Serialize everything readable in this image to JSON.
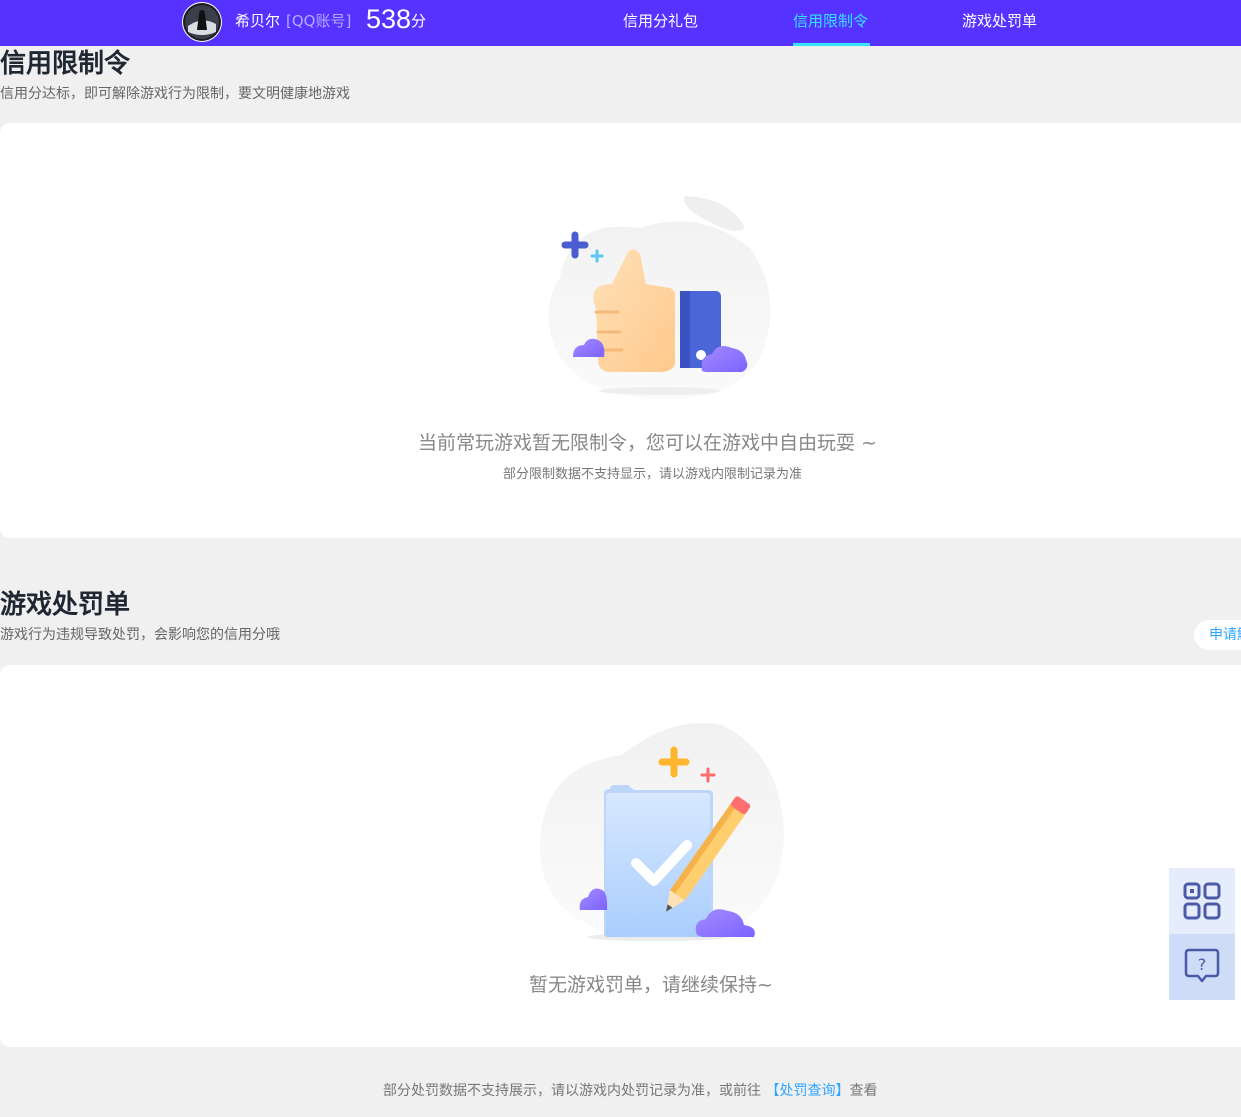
{
  "header": {
    "user_name": "希贝尔",
    "account_tag": "[QQ账号]",
    "score": "538",
    "score_unit": "分",
    "nav": [
      {
        "label": "信用分礼包",
        "active": false
      },
      {
        "label": "信用限制令",
        "active": true
      },
      {
        "label": "游戏处罚单",
        "active": false
      }
    ]
  },
  "limit_section": {
    "title": "信用限制令",
    "subtitle": "信用分达标，即可解除游戏行为限制，要文明健康地游戏",
    "empty_main": "当前常玩游戏暂无限制令，您可以在游戏中自由玩耍 ~",
    "empty_sub": "部分限制数据不支持显示，请以游戏内限制记录为准"
  },
  "punish_section": {
    "title": "游戏处罚单",
    "subtitle": "游戏行为违规导致处罚，会影响您的信用分哦",
    "apply_label": "申请解",
    "empty_main": "暂无游戏罚单，请继续保持~"
  },
  "footer": {
    "note_prefix": "部分处罚数据不支持展示，请以游戏内处罚记录为准，或前往",
    "link_label": "【处罚查询】",
    "note_suffix": "查看"
  },
  "colors": {
    "header_bg": "#5632ff",
    "active_nav": "#35e2ff",
    "link": "#2fa6ff"
  },
  "icons": {
    "qr": "qr-code-icon",
    "help": "help-chat-icon"
  }
}
